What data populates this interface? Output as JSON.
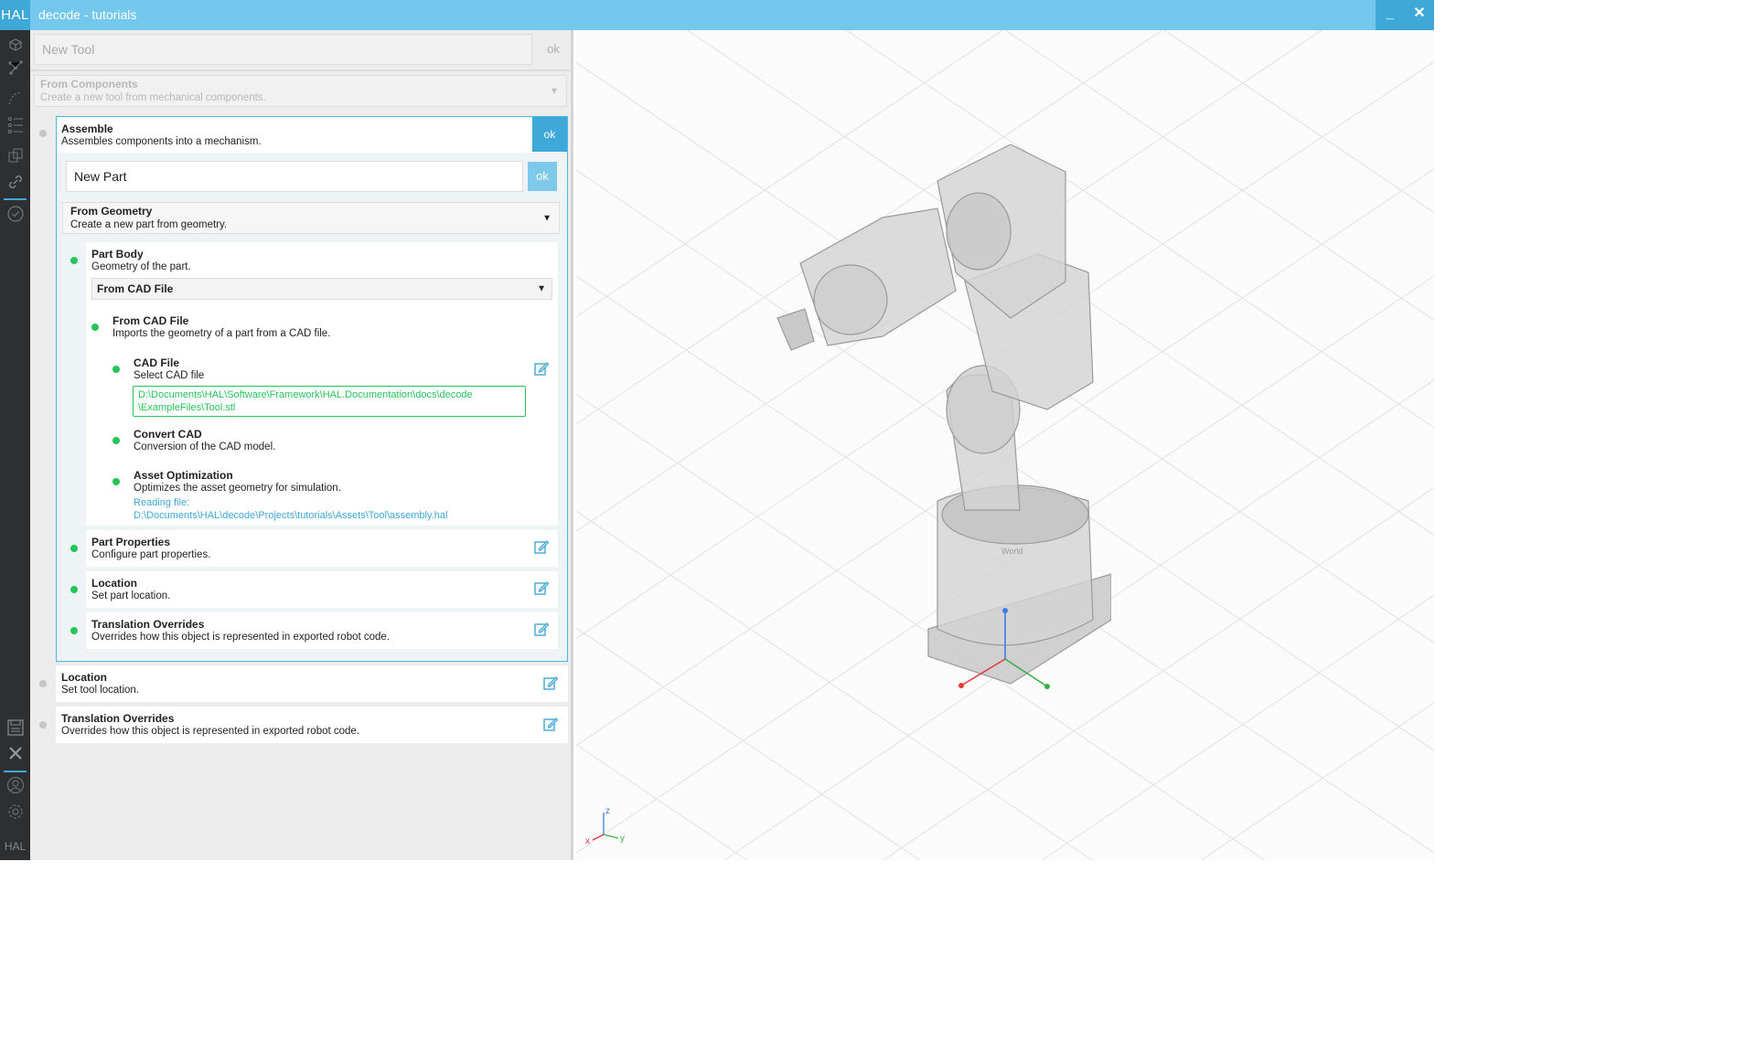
{
  "window": {
    "logo": "HAL",
    "title": "decode - tutorials",
    "minimize_label": "_",
    "close_label": "✕"
  },
  "rail": {
    "icons": [
      "cube-icon",
      "graph-icon",
      "list-icon",
      "components-icon",
      "link-icon",
      "check-icon",
      "save-icon",
      "close-icon",
      "user-icon",
      "settings-icon"
    ],
    "footer": "HAL",
    "accent": "#3ea8d9"
  },
  "tool": {
    "name_placeholder": "New Tool",
    "ok_label": "ok",
    "source": {
      "title": "From Components",
      "description": "Create a new tool from mechanical components."
    }
  },
  "assemble": {
    "title": "Assemble",
    "description": "Assembles components into a mechanism.",
    "ok_label": "ok",
    "part": {
      "name_value": "New Part",
      "ok_label": "ok",
      "source": {
        "title": "From Geometry",
        "description": "Create a new part from geometry."
      },
      "body": {
        "title": "Part Body",
        "description": "Geometry of the part.",
        "source_selected": "From CAD File"
      },
      "cad": {
        "title": "From CAD File",
        "description": "Imports the geometry of a part from a CAD file.",
        "file": {
          "title": "CAD File",
          "description": "Select CAD file",
          "path_line1": "D:\\Documents\\HAL\\Software\\Framework\\HAL.Documentation\\docs\\decode",
          "path_line2": "\\ExampleFiles\\Tool.stl"
        },
        "convert": {
          "title": "Convert CAD",
          "description": "Conversion of the CAD model."
        },
        "optimization": {
          "title": "Asset Optimization",
          "description": "Optimizes the asset geometry for simulation.",
          "status_line1": "Reading file:",
          "status_line2": "D:\\Documents\\HAL\\decode\\Projects\\tutorials\\Assets\\Tool\\assembly.hal"
        }
      },
      "properties": {
        "title": "Part Properties",
        "description": "Configure part properties."
      },
      "location": {
        "title": "Location",
        "description": "Set part location."
      },
      "overrides": {
        "title": "Translation Overrides",
        "description": "Overrides how this object is represented in exported robot code."
      }
    }
  },
  "tool_location": {
    "title": "Location",
    "description": "Set tool location."
  },
  "tool_overrides": {
    "title": "Translation Overrides",
    "description": "Overrides how this object is represented in exported robot code."
  },
  "viewport": {
    "world_label": "World",
    "axis_z": "z",
    "axis_y": "y",
    "axis_x": "x"
  },
  "colors": {
    "accent": "#3ea8d9",
    "valid": "#27c459",
    "pending": "#c6c6c6"
  }
}
